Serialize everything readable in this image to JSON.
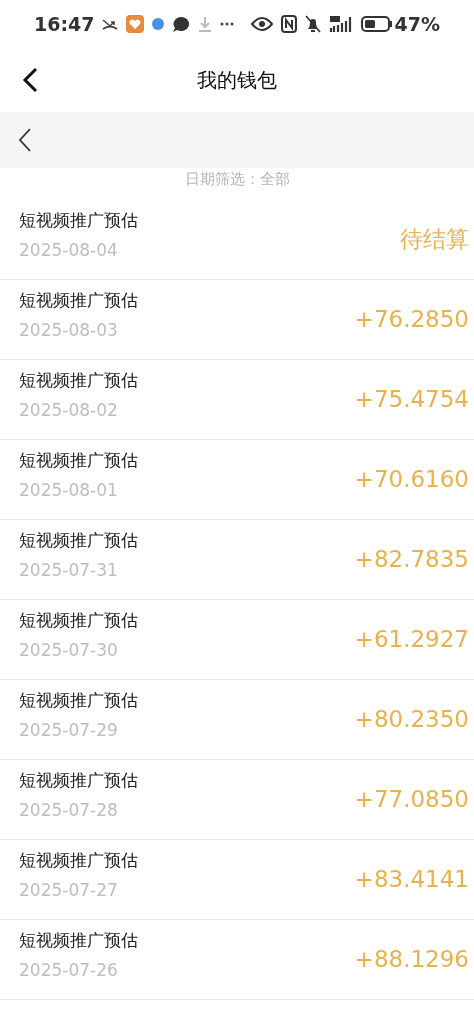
{
  "status_bar": {
    "time": "16:47",
    "battery": "47%"
  },
  "header": {
    "title": "我的钱包"
  },
  "filter": {
    "text": "日期筛选：全部"
  },
  "records": [
    {
      "title": "短视频推广预估",
      "date": "2025-08-04",
      "amount": "待结算"
    },
    {
      "title": "短视频推广预估",
      "date": "2025-08-03",
      "amount": "+76.2850"
    },
    {
      "title": "短视频推广预估",
      "date": "2025-08-02",
      "amount": "+75.4754"
    },
    {
      "title": "短视频推广预估",
      "date": "2025-08-01",
      "amount": "+70.6160"
    },
    {
      "title": "短视频推广预估",
      "date": "2025-07-31",
      "amount": "+82.7835"
    },
    {
      "title": "短视频推广预估",
      "date": "2025-07-30",
      "amount": "+61.2927"
    },
    {
      "title": "短视频推广预估",
      "date": "2025-07-29",
      "amount": "+80.2350"
    },
    {
      "title": "短视频推广预估",
      "date": "2025-07-28",
      "amount": "+77.0850"
    },
    {
      "title": "短视频推广预估",
      "date": "2025-07-27",
      "amount": "+83.4141"
    },
    {
      "title": "短视频推广预估",
      "date": "2025-07-26",
      "amount": "+88.1296"
    }
  ]
}
